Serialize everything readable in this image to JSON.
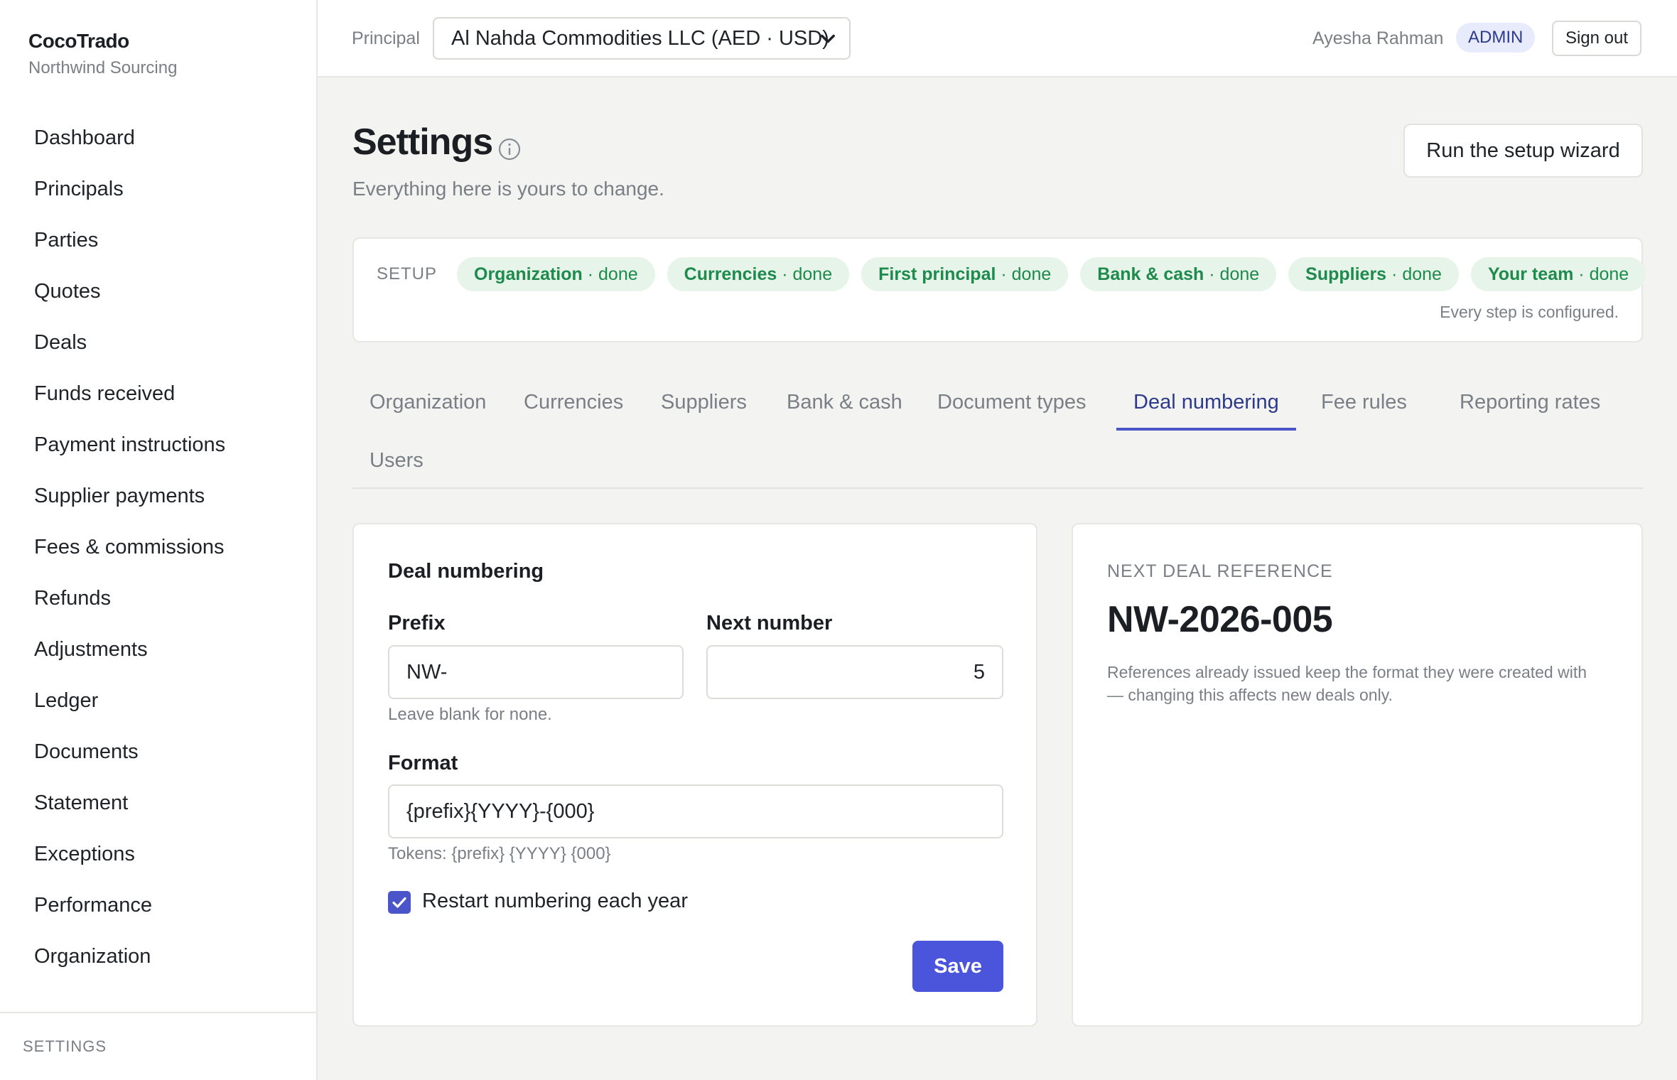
{
  "brand": {
    "name": "CocoTrado",
    "subtitle": "Northwind Sourcing"
  },
  "sidebar": {
    "items": [
      "Dashboard",
      "Principals",
      "Parties",
      "Quotes",
      "Deals",
      "Funds received",
      "Payment instructions",
      "Supplier payments",
      "Fees & commissions",
      "Refunds",
      "Adjustments",
      "Ledger",
      "Documents",
      "Statement",
      "Exceptions",
      "Performance",
      "Organization"
    ],
    "footer_section": "SETTINGS"
  },
  "topbar": {
    "principal_label": "Principal",
    "principal_selected": "Al Nahda Commodities LLC (AED · USD)",
    "user_name": "Ayesha Rahman",
    "role": "ADMIN",
    "signout_label": "Sign out"
  },
  "page": {
    "title": "Settings",
    "subtitle": "Everything here is yours to change.",
    "wizard_button": "Run the setup wizard"
  },
  "setup": {
    "label": "SETUP",
    "status_word": "done",
    "steps": [
      "Organization",
      "Currencies",
      "First principal",
      "Bank & cash",
      "Suppliers",
      "Your team"
    ],
    "note": "Every step is configured.",
    "chip_color": "#1e8a4c",
    "chip_bg": "#e6f4ea"
  },
  "tabs": {
    "items": [
      "Organization",
      "Currencies",
      "Suppliers",
      "Bank & cash",
      "Document types",
      "Deal numbering",
      "Fee rules",
      "Reporting rates",
      "Users"
    ],
    "active": "Deal numbering"
  },
  "deal_numbering": {
    "title": "Deal numbering",
    "prefix_label": "Prefix",
    "prefix_value": "NW-",
    "prefix_hint": "Leave blank for none.",
    "next_number_label": "Next number",
    "next_number_value": "5",
    "format_label": "Format",
    "format_value": "{prefix}{YYYY}-{000}",
    "format_hint": "Tokens: {prefix} {YYYY} {000}",
    "restart_label": "Restart numbering each year",
    "restart_checked": true,
    "save_label": "Save"
  },
  "preview": {
    "label": "NEXT DEAL REFERENCE",
    "value": "NW-2026-005",
    "note": "References already issued keep the format they were created with — changing this affects new deals only."
  },
  "colors": {
    "accent": "#4a55dc",
    "active_tab": "#2d3a8c",
    "badge_bg": "#e7ebfb"
  }
}
